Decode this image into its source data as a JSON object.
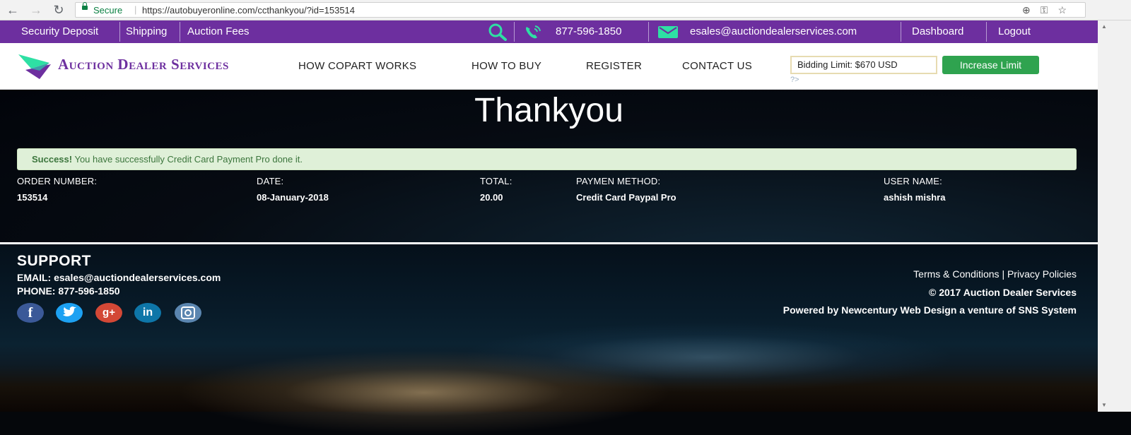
{
  "browser": {
    "back_icon": "back-arrow-icon",
    "forward_icon": "forward-arrow-icon",
    "reload_icon": "reload-icon",
    "secure_label": "Secure",
    "url": "https://autobuyeronline.com/ccthankyou/?id=153514"
  },
  "topbar": {
    "links": [
      "Security Deposit",
      "Shipping",
      "Auction Fees"
    ],
    "phone": "877-596-1850",
    "email": "esales@auctiondealerservices.com",
    "dashboard": "Dashboard",
    "logout": "Logout",
    "color": "#6d2f9f"
  },
  "header": {
    "logo_text": "Auction Dealer Services",
    "menu": [
      "HOW COPART WORKS",
      "HOW TO BUY",
      "REGISTER",
      "CONTACT US"
    ],
    "bidding_limit": "Bidding Limit: $670 USD",
    "increase_button": "Increase Limit",
    "php_tag": "?>"
  },
  "main": {
    "title": "Thankyou",
    "alert_strong": "Success!",
    "alert_text": " You have successfully Credit Card Payment Pro done it.",
    "order": {
      "labels": [
        "ORDER NUMBER:",
        "DATE:",
        "TOTAL:",
        "PAYMEN METHOD:",
        "USER NAME:"
      ],
      "values": [
        "153514",
        "08-January-2018",
        "20.00",
        "Credit Card Paypal Pro",
        "ashish mishra"
      ]
    }
  },
  "footer": {
    "title": "SUPPORT",
    "email_line": "EMAIL: esales@auctiondealerservices.com",
    "phone_line": "PHONE: 877-596-1850",
    "social_icons": [
      "facebook-icon",
      "twitter-icon",
      "google-plus-icon",
      "linkedin-icon",
      "instagram-icon"
    ],
    "links": "Terms & Conditions | Privacy Policies",
    "copyright": "© 2017 Auction Dealer Services",
    "powered": "Powered by Newcentury Web Design a venture of SNS System"
  }
}
